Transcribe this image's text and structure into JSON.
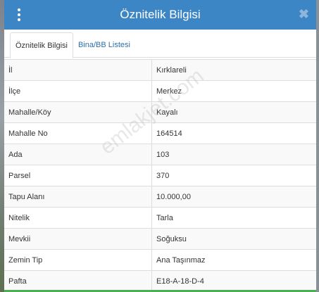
{
  "header": {
    "title": "Öznitelik Bilgisi"
  },
  "tabs": [
    {
      "label": "Öznitelik Bilgisi",
      "active": true
    },
    {
      "label": "Bina/BB Listesi",
      "active": false
    }
  ],
  "attributes": [
    {
      "key": "İl",
      "value": "Kırklareli"
    },
    {
      "key": "İlçe",
      "value": "Merkez"
    },
    {
      "key": "Mahalle/Köy",
      "value": "Kayalı"
    },
    {
      "key": "Mahalle No",
      "value": "164514"
    },
    {
      "key": "Ada",
      "value": "103"
    },
    {
      "key": "Parsel",
      "value": "370"
    },
    {
      "key": "Tapu Alanı",
      "value": "10.000,00"
    },
    {
      "key": "Nitelik",
      "value": "Tarla"
    },
    {
      "key": "Mevkii",
      "value": "Soğuksu"
    },
    {
      "key": "Zemin Tip",
      "value": "Ana Taşınmaz"
    },
    {
      "key": "Pafta",
      "value": "E18-A-18-D-4"
    }
  ],
  "watermark": "emlakjet.com",
  "colors": {
    "header": "#3d86c6",
    "accent": "#4caf50",
    "link": "#2a6fab"
  }
}
